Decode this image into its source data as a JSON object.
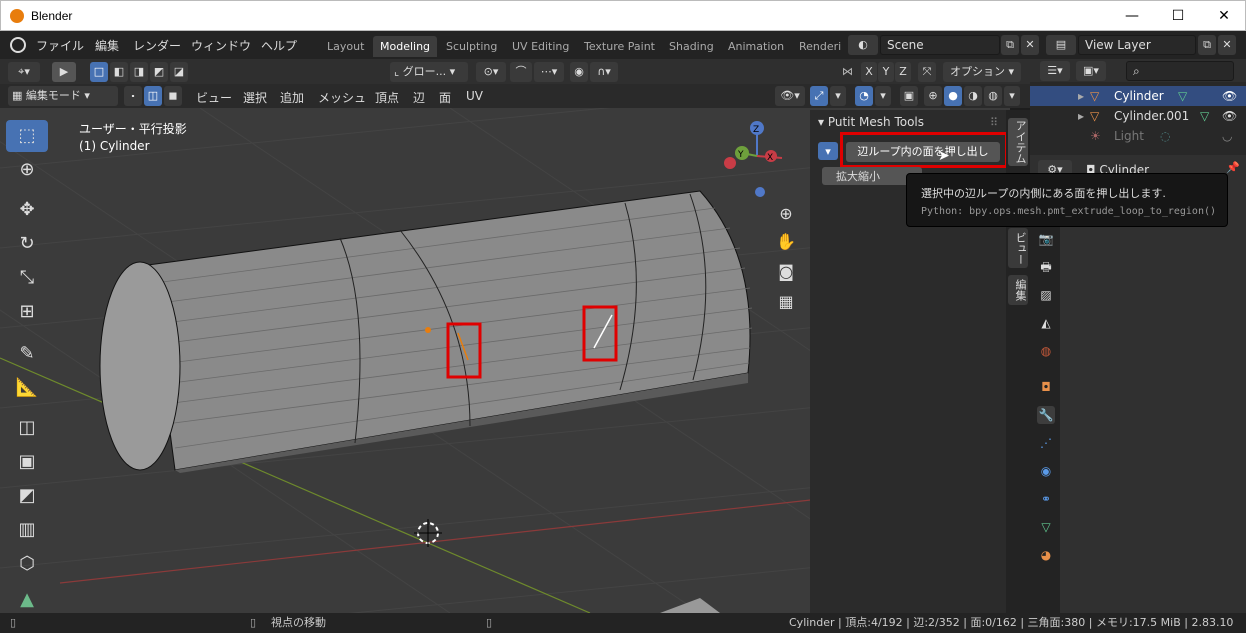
{
  "window": {
    "title": "Blender",
    "minimize": "—",
    "maximize": "☐",
    "close": "✕"
  },
  "menu": [
    "ファイル",
    "編集",
    "レンダー",
    "ウィンドウ",
    "ヘルプ"
  ],
  "workspaces": [
    "Layout",
    "Modeling",
    "Sculpting",
    "UV Editing",
    "Texture Paint",
    "Shading",
    "Animation",
    "Renderi"
  ],
  "active_workspace": "Modeling",
  "scene": {
    "label": "Scene",
    "view_layer": "View Layer"
  },
  "header": {
    "orientation": "グロー...",
    "axes": [
      "X",
      "Y",
      "Z"
    ],
    "options": "オプション",
    "mode": "編集モード",
    "menus": [
      "ビュー",
      "選択",
      "追加",
      "メッシュ",
      "頂点",
      "辺",
      "面",
      "UV"
    ]
  },
  "viewport": {
    "view_name": "ユーザー・平行投影",
    "object": "(1) Cylinder"
  },
  "gizmo": {
    "x": "X",
    "y": "Y",
    "z": "Z"
  },
  "npanel": {
    "panel_title": "Putit Mesh Tools",
    "button_extrude": "辺ループ内の面を押し出し",
    "button_scale": "拡大縮小",
    "tabs": [
      "アイテム",
      "ビュー",
      "編集"
    ]
  },
  "tooltip": {
    "text": "選択中の辺ループの内側にある面を押し出します.",
    "python": "Python: bpy.ops.mesh.pmt_extrude_loop_to_region()"
  },
  "outliner": {
    "items": [
      {
        "name": "Cylinder",
        "selected": true
      },
      {
        "name": "Cylinder.001",
        "selected": false
      },
      {
        "name": "Light",
        "selected": false
      }
    ]
  },
  "properties": {
    "object": "Cylinder"
  },
  "statusbar": {
    "hint": "視点の移動",
    "stats": "Cylinder | 頂点:4/192 | 辺:2/352 | 面:0/162 | 三角面:380 | メモリ:17.5 MiB | 2.83.10"
  },
  "colors": {
    "accent": "#4772b3",
    "highlight_red": "#e00000",
    "orange": "#e87d0d"
  }
}
